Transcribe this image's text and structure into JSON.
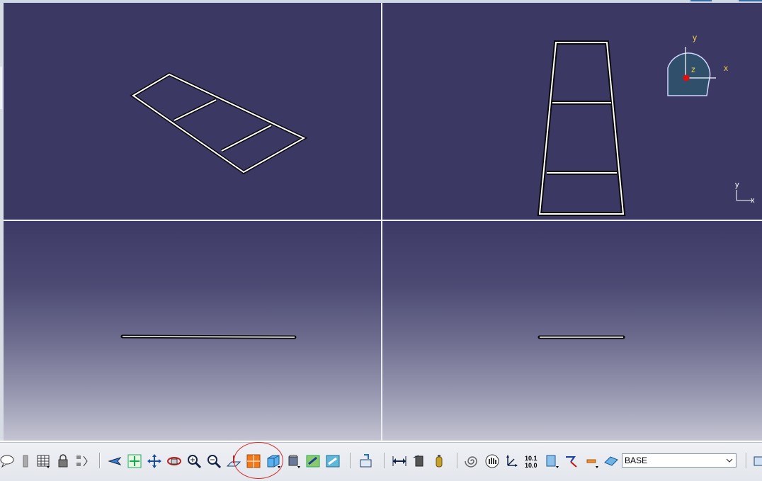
{
  "viewport": {
    "compass": {
      "x_label": "x",
      "y_label": "y",
      "z_label": "z"
    },
    "axis_triad": {
      "x_label": "x",
      "y_label": "y"
    }
  },
  "toolbar": {
    "layer_combo": {
      "value": "BASE"
    },
    "buttons": [
      "speech-bubble-icon",
      "fastener-icon",
      "table-grid-icon",
      "lock-icon",
      "tree-icon",
      "fly-mode-icon",
      "fit-all-icon",
      "pan-icon",
      "rotate-icon",
      "zoom-in-icon",
      "zoom-out-icon",
      "normal-view-icon",
      "multi-view-icon",
      "iso-view-icon",
      "shading-icon",
      "hide-show-icon",
      "swap-visible-icon",
      "create-block-icon",
      "measure-between-icon",
      "measure-item-icon",
      "measure-inertia-icon",
      "spiral-icon",
      "grab-hand-icon",
      "axis-system-icon",
      "dimension-icon",
      "copy-icon",
      "sketch-pointer-icon",
      "snap-icon",
      "plane-icon"
    ],
    "annotation": {
      "color": "#d22a2a"
    }
  },
  "colors": {
    "viewport_top": "#3b3864",
    "model_stroke": "#0a0a0a",
    "model_fill": "#ffffff"
  }
}
